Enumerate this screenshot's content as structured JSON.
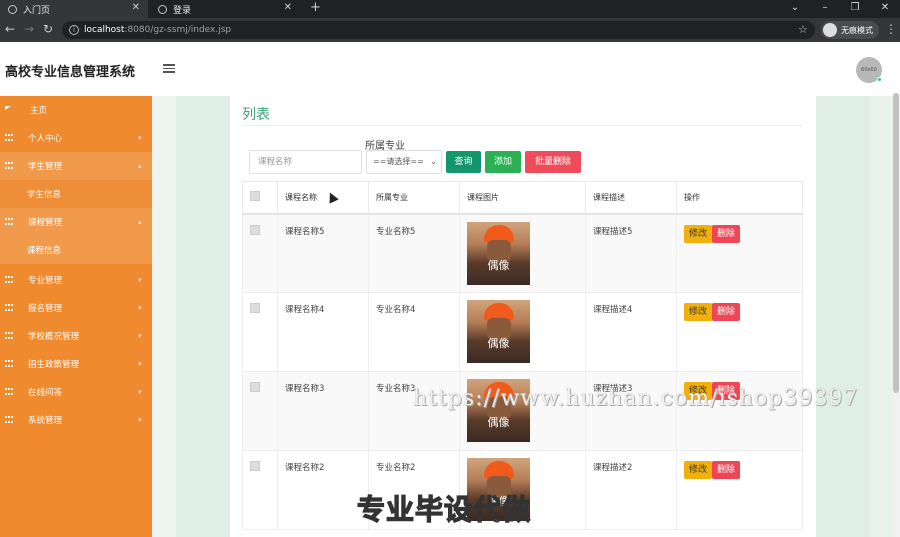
{
  "browser": {
    "tabs": [
      {
        "title": "入门页"
      },
      {
        "title": "登录"
      }
    ],
    "url_host": "localhost",
    "url_path": ":8080/gz-ssmj/index.jsp",
    "incognito_label": "无痕模式"
  },
  "app": {
    "title": "高校专业信息管理系统",
    "avatar_text": "60x60"
  },
  "sidebar": {
    "items": [
      {
        "label": "主页"
      },
      {
        "label": "个人中心"
      },
      {
        "label": "学生管理"
      },
      {
        "label": "学生信息"
      },
      {
        "label": "课程管理"
      },
      {
        "label": "课程信息"
      },
      {
        "label": "专业管理"
      },
      {
        "label": "报名管理"
      },
      {
        "label": "学校概况管理"
      },
      {
        "label": "招生政策管理"
      },
      {
        "label": "在线问答"
      },
      {
        "label": "系统管理"
      }
    ]
  },
  "main": {
    "title": "列表",
    "filter_label": "所属专业",
    "search_placeholder": "课程名称",
    "select_value": "==请选择==",
    "btn_query": "查询",
    "btn_add": "添加",
    "btn_batch_delete": "批量删除",
    "columns": [
      "课程名称",
      "所属专业",
      "课程图片",
      "课程描述",
      "操作"
    ],
    "image_caption": "偶像",
    "rows": [
      {
        "name": "课程名称5",
        "major": "专业名称5",
        "desc": "课程描述5"
      },
      {
        "name": "课程名称4",
        "major": "专业名称4",
        "desc": "课程描述4"
      },
      {
        "name": "课程名称3",
        "major": "专业名称3",
        "desc": "课程描述3"
      },
      {
        "name": "课程名称2",
        "major": "专业名称2",
        "desc": "课程描述2"
      }
    ],
    "btn_edit": "修改",
    "btn_delete": "删除"
  },
  "overlays": {
    "watermark_url": "https://www.huzhan.com/ishop39397",
    "watermark_text": "专业毕设代做"
  }
}
